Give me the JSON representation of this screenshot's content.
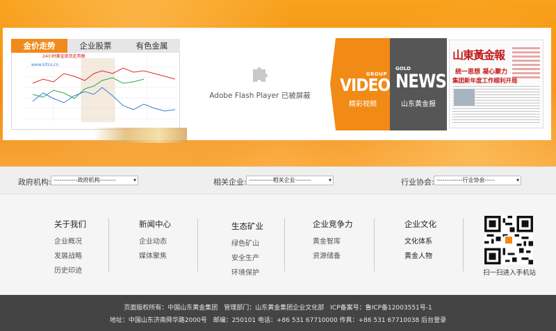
{
  "chart_widget": {
    "tabs": [
      {
        "label": "金价走势",
        "active": true
      },
      {
        "label": "企业股票",
        "active": false
      },
      {
        "label": "有色金属",
        "active": false
      }
    ],
    "chart_title": "24小时黄金现货走势图",
    "watermark": "www.kitco.cn"
  },
  "flash": {
    "message": "Adobe Flash Player 已被屏蔽"
  },
  "media": {
    "group_label": "GROUP",
    "video_label": "VIDEO",
    "video_sub": "精彩视频",
    "gold_label": "GOLD",
    "news_label": "NEWS",
    "news_sub": "山东黄金报",
    "paper_title": "山東黃金報",
    "paper_headline_1": "统一思想 凝心聚力",
    "paper_headline_2": "集团新年度工作顺利开局"
  },
  "filters": {
    "gov_label": "政府机构:",
    "gov_select": "------------政府机构--------",
    "company_label": "相关企业:",
    "company_select": "------------相关企业--------",
    "assoc_label": "行业协会:",
    "assoc_select": "-------------行业协会-----"
  },
  "footer_nav": {
    "columns": [
      {
        "title": "关于我们",
        "items": [
          "企业概况",
          "发展战略",
          "历史印迹"
        ]
      },
      {
        "title": "新闻中心",
        "items": [
          "企业动态",
          "媒体聚焦"
        ]
      },
      {
        "title": "生态矿业",
        "items": [
          "绿色矿山",
          "安全生产",
          "环境保护"
        ]
      },
      {
        "title": "企业竞争力",
        "items": [
          "黄金智库",
          "资源储备"
        ]
      },
      {
        "title": "企业文化",
        "items": [
          "文化体系",
          "黄金人物"
        ]
      }
    ],
    "qr_caption": "扫一扫进入手机站"
  },
  "bottom_footer": {
    "line1": "页面版权所有：中国山东黄金集团　管理部门：山东黄金集团企业文化部　ICP备案号：鲁ICP备12003551号-1",
    "line2": "地址：中国山东济南舜华路2000号　邮编：250101 电话：+86 531 67710000 传真：+86 531 67710038 后台登录"
  },
  "colors": {
    "accent_orange": "#f28a16",
    "dark_gray": "#565656",
    "footer_bg": "#444444"
  }
}
